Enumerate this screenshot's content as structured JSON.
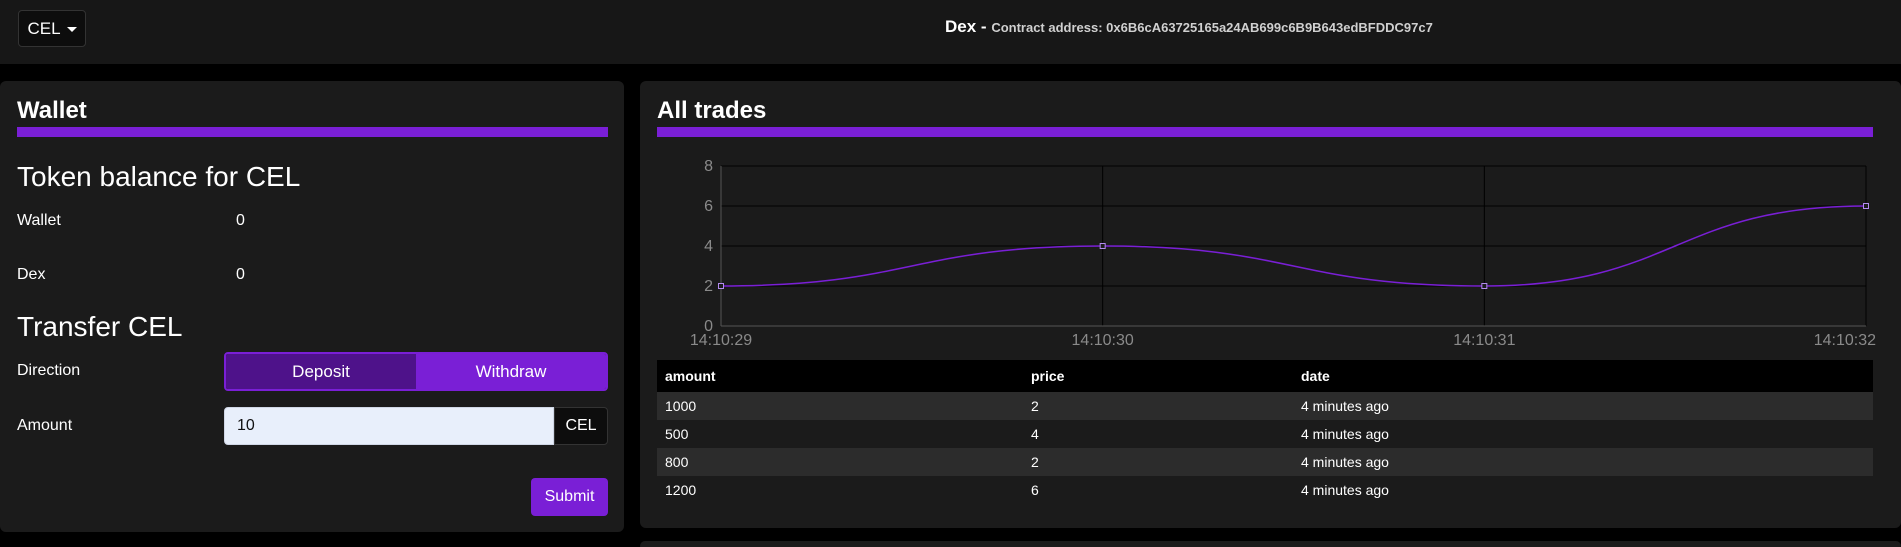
{
  "navbar": {
    "token_selector": "CEL",
    "title": "Dex -",
    "contract_address": "Contract address: 0x6B6cA63725165a24AB699c6B9B643edBFDDC97c7"
  },
  "wallet": {
    "title": "Wallet",
    "balance_heading": "Token balance for CEL",
    "rows": [
      {
        "label": "Wallet",
        "value": "0"
      },
      {
        "label": "Dex",
        "value": "0"
      }
    ],
    "transfer_heading": "Transfer CEL",
    "direction_label": "Direction",
    "deposit_label": "Deposit",
    "withdraw_label": "Withdraw",
    "selected_direction": "Withdraw",
    "amount_label": "Amount",
    "amount_value": "10",
    "amount_unit": "CEL",
    "submit_label": "Submit"
  },
  "trades": {
    "title": "All trades",
    "columns": [
      "amount",
      "price",
      "date"
    ],
    "rows": [
      [
        "1000",
        "2",
        "4 minutes ago"
      ],
      [
        "500",
        "4",
        "4 minutes ago"
      ],
      [
        "800",
        "2",
        "4 minutes ago"
      ],
      [
        "1200",
        "6",
        "4 minutes ago"
      ]
    ]
  },
  "colors": {
    "accent": "#7a1fd6",
    "accent_dark": "#4e128a",
    "card_bg": "#1b1b1b"
  },
  "chart_data": {
    "type": "line",
    "x": [
      "14:10:29",
      "14:10:30",
      "14:10:31",
      "14:10:32"
    ],
    "series": [
      {
        "values": [
          2,
          4,
          2,
          6
        ]
      }
    ],
    "y_ticks": [
      "0",
      "2",
      "4",
      "6",
      "8"
    ],
    "ylim": [
      0,
      8
    ],
    "grid": true,
    "color": "#7a1fd6"
  }
}
